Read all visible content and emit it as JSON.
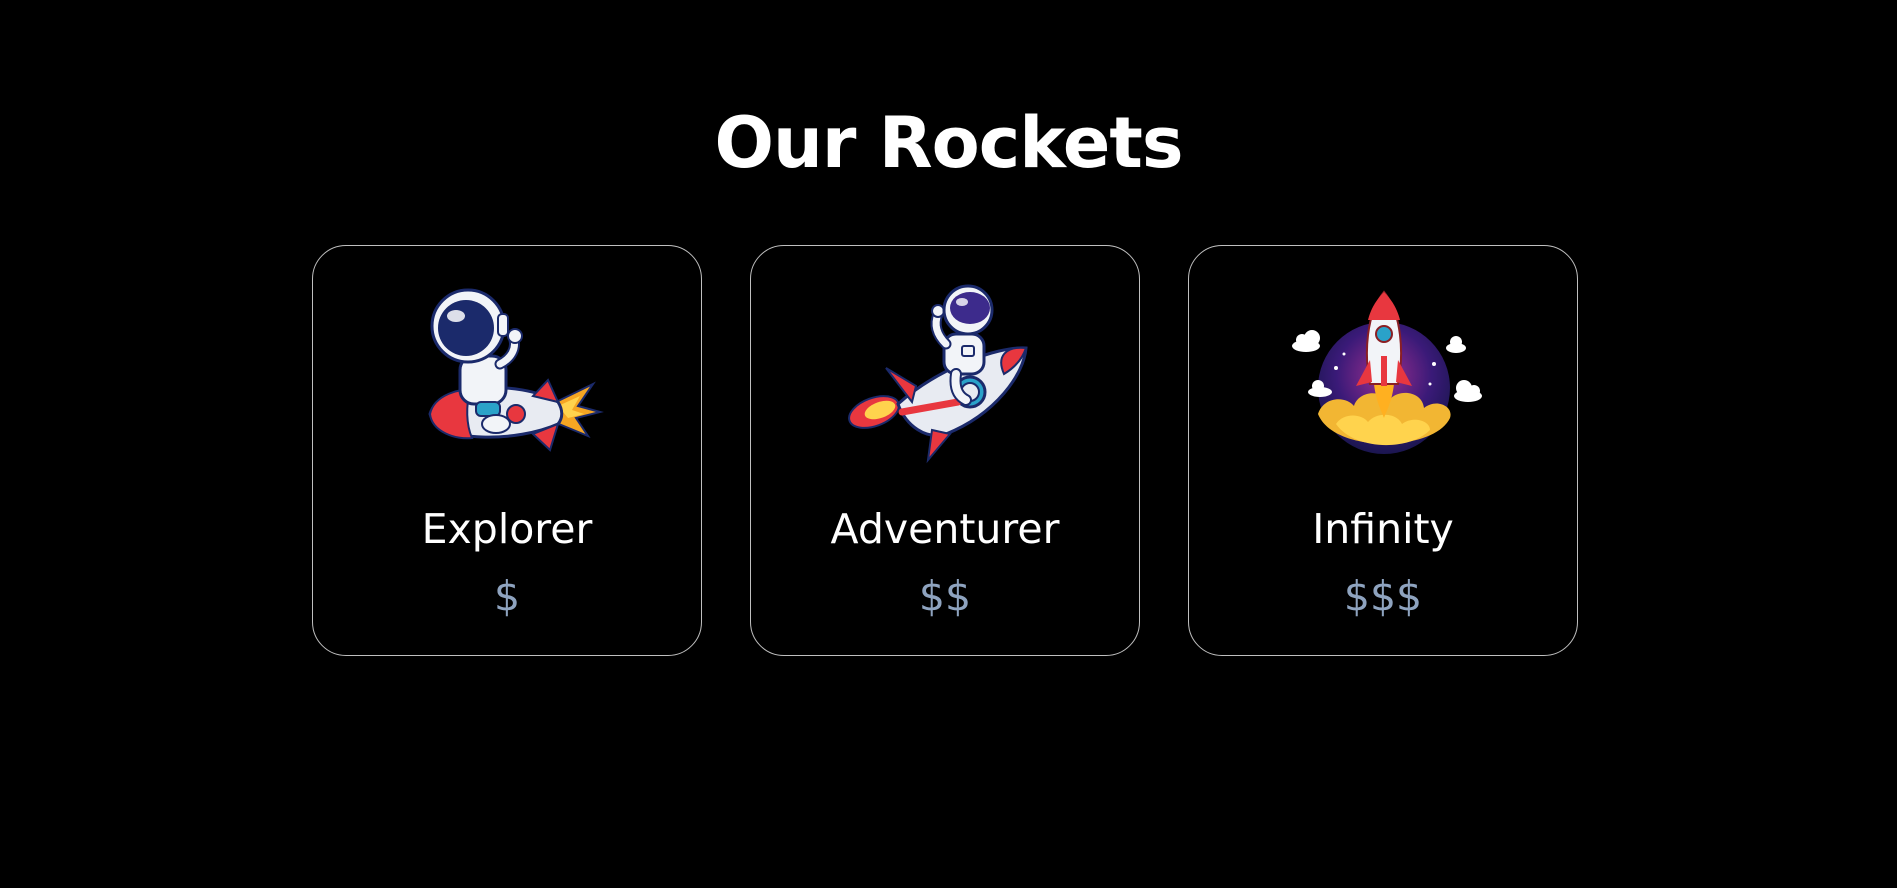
{
  "page": {
    "title": "Our Rockets"
  },
  "rockets": [
    {
      "name": "Explorer",
      "price": "$",
      "illustration": "astronaut-riding-rocket-icon"
    },
    {
      "name": "Adventurer",
      "price": "$$",
      "illustration": "astronaut-flying-rocket-icon"
    },
    {
      "name": "Infinity",
      "price": "$$$",
      "illustration": "rocket-launch-icon"
    }
  ],
  "colors": {
    "background": "#000000",
    "title": "#ffffff",
    "card_border": "#bfbfbf",
    "name": "#ffffff",
    "price": "#8ea3bf"
  }
}
